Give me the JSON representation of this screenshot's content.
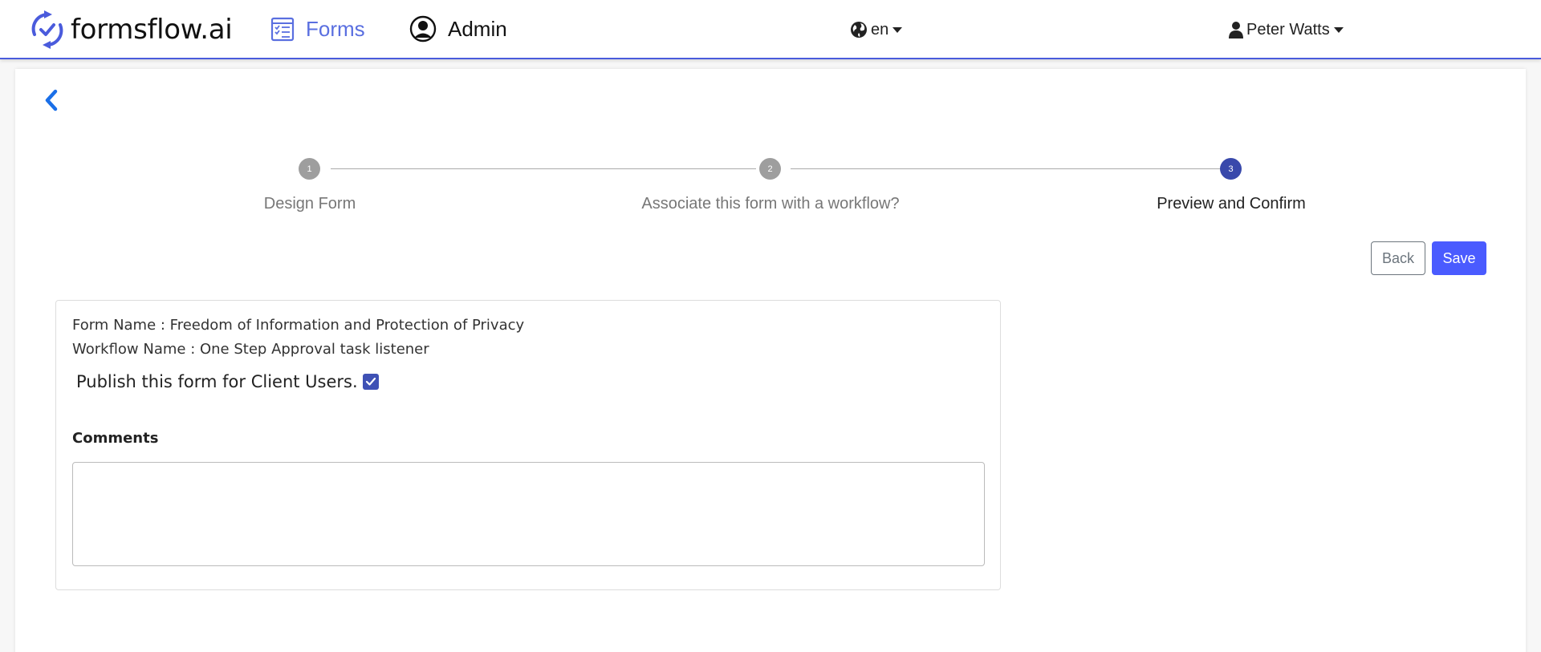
{
  "navbar": {
    "brand": "formsflow.ai",
    "forms_label": "Forms",
    "admin_label": "Admin",
    "language": "en",
    "user_name": "Peter Watts",
    "accent_color": "#4a5bdc"
  },
  "stepper": {
    "steps": [
      {
        "number": "1",
        "label": "Design Form",
        "state": "done"
      },
      {
        "number": "2",
        "label": "Associate this form with a workflow?",
        "state": "done"
      },
      {
        "number": "3",
        "label": "Preview and Confirm",
        "state": "active"
      }
    ]
  },
  "actions": {
    "back_label": "Back",
    "save_label": "Save"
  },
  "preview": {
    "form_name_line": "Form Name : Freedom of Information and Protection of Privacy",
    "workflow_name_line": "Workflow Name : One Step Approval task listener",
    "publish_label": "Publish this form for Client Users.",
    "publish_checked": true,
    "comments_label": "Comments",
    "comments_value": ""
  }
}
